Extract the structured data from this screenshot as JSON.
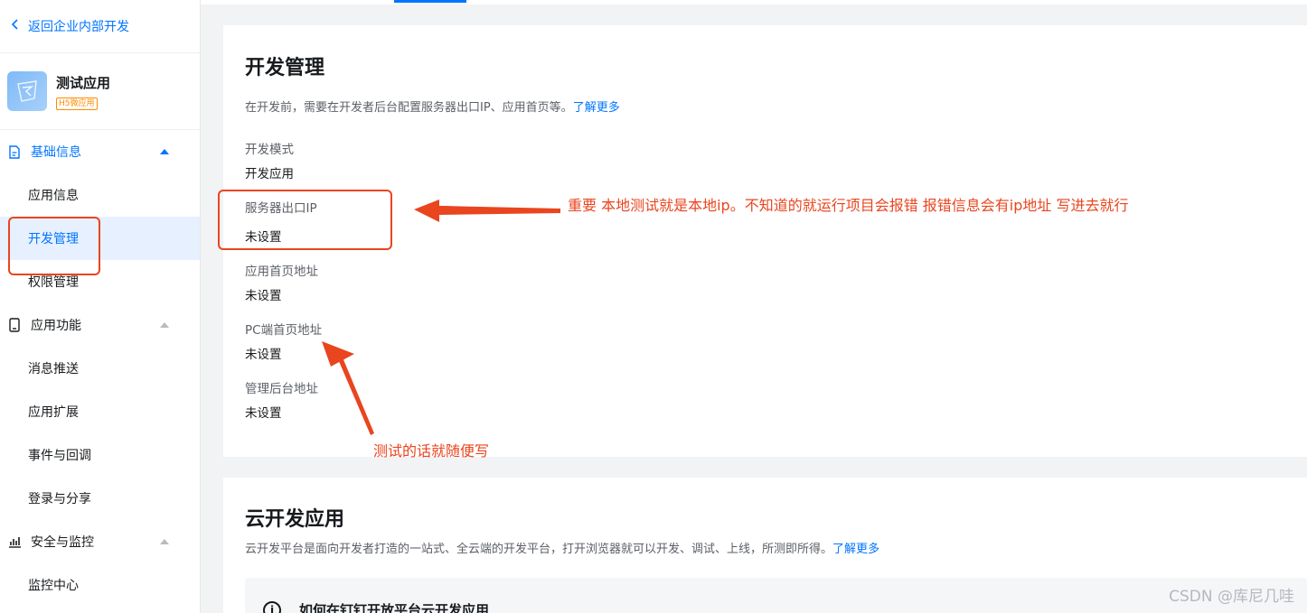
{
  "sidebar": {
    "back_label": "返回企业内部开发",
    "app": {
      "name": "测试应用",
      "tag": "H5微应用"
    },
    "groups": [
      {
        "label": "基础信息",
        "icon": "document-icon",
        "items": [
          "应用信息",
          "开发管理",
          "权限管理"
        ]
      },
      {
        "label": "应用功能",
        "icon": "phone-icon",
        "items": [
          "消息推送",
          "应用扩展",
          "事件与回调",
          "登录与分享"
        ]
      },
      {
        "label": "安全与监控",
        "icon": "bar-chart-icon",
        "items": [
          "监控中心"
        ]
      }
    ],
    "selected_item": "开发管理"
  },
  "dev_panel": {
    "title": "开发管理",
    "desc": "在开发前，需要在开发者后台配置服务器出口IP、应用首页等。",
    "more_link": "了解更多",
    "fields": [
      {
        "label": "开发模式",
        "value": "开发应用"
      },
      {
        "label": "服务器出口IP",
        "value": "未设置"
      },
      {
        "label": "应用首页地址",
        "value": "未设置"
      },
      {
        "label": "PC端首页地址",
        "value": "未设置"
      },
      {
        "label": "管理后台地址",
        "value": "未设置"
      }
    ]
  },
  "cloud_panel": {
    "title": "云开发应用",
    "desc": "云开发平台是面向开发者打造的一站式、全云端的开发平台，打开浏览器就可以开发、调试、上线，所测即所得。",
    "more_link": "了解更多",
    "help_title": "如何在钉钉开放平台云开发应用",
    "help_icon_glyph": "i"
  },
  "annotations": {
    "ip_note": "重要 本地测试就是本地ip。不知道的就运行项目会报错 报错信息会有ip地址 写进去就行",
    "test_note": "测试的话就随便写"
  },
  "watermark": "CSDN @库尼几哇",
  "colors": {
    "accent": "#0075ff",
    "annotation": "#e9451f",
    "tag": "#ff8a00"
  }
}
